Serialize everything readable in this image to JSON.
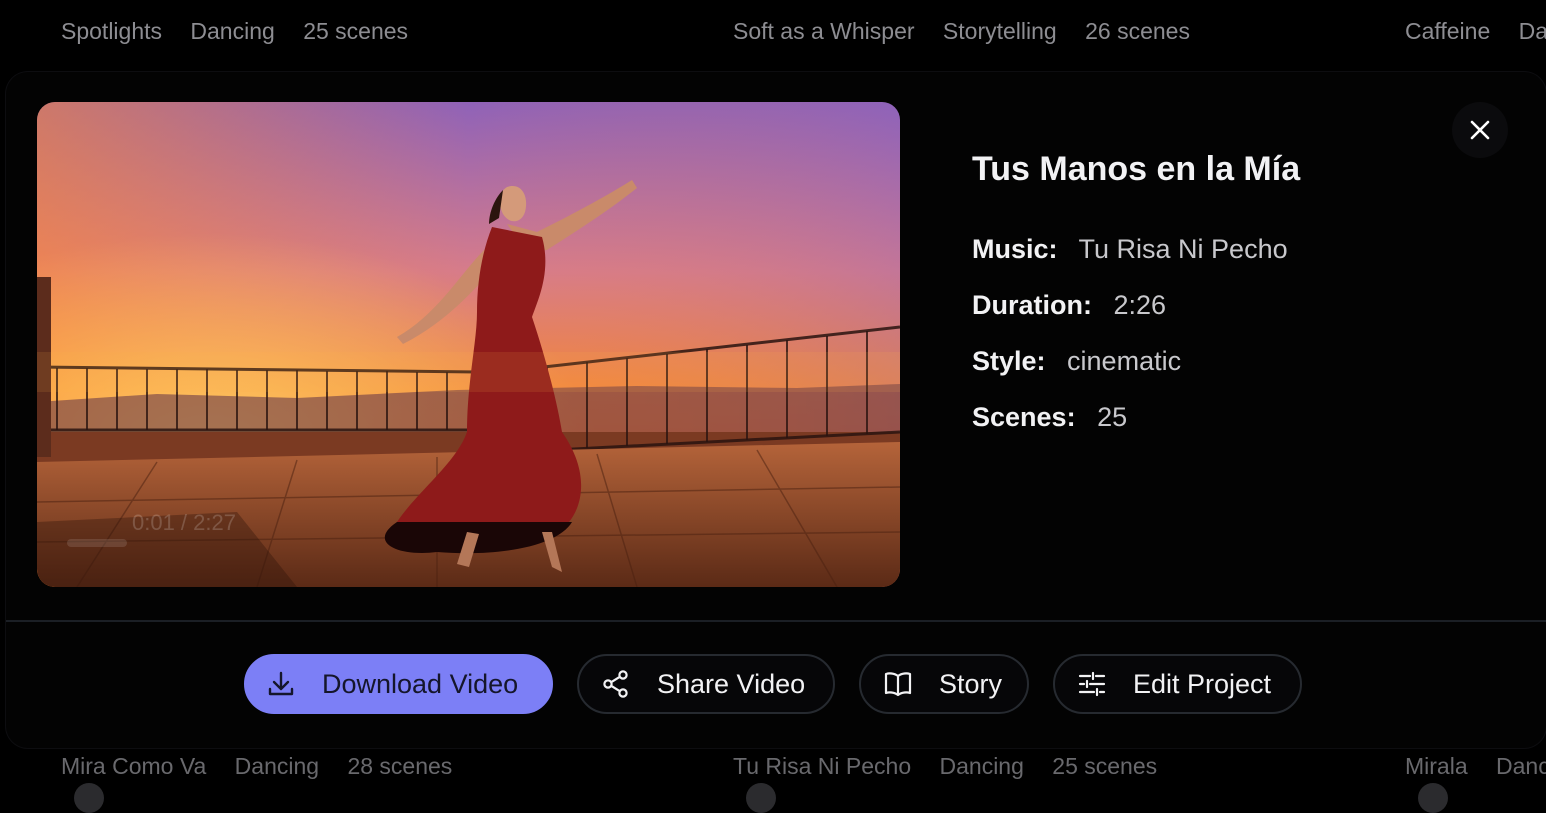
{
  "background_top": {
    "groups": [
      {
        "title": "Spotlights",
        "category": "Dancing",
        "scenes": "25 scenes"
      },
      {
        "title": "Soft as a Whisper",
        "category": "Storytelling",
        "scenes": "26 scenes"
      },
      {
        "title": "Caffeine",
        "category": "Da"
      }
    ]
  },
  "background_bottom": {
    "groups": [
      {
        "title": "Mira Como Va",
        "category": "Dancing",
        "scenes": "28 scenes"
      },
      {
        "title": "Tu Risa Ni Pecho",
        "category": "Dancing",
        "scenes": "25 scenes"
      },
      {
        "title": "Mirala",
        "category": "Danc"
      }
    ]
  },
  "modal": {
    "media": {
      "time": "0:01 / 2:27"
    },
    "title": "Tus Manos en la Mía",
    "details": [
      {
        "label": "Music:",
        "value": "Tu Risa Ni Pecho"
      },
      {
        "label": "Duration:",
        "value": "2:26"
      },
      {
        "label": "Style:",
        "value": "cinematic"
      },
      {
        "label": "Scenes:",
        "value": "25"
      }
    ],
    "actions": {
      "download": "Download Video",
      "share": "Share Video",
      "story": "Story",
      "edit": "Edit Project"
    },
    "icons": {
      "close": "close-icon",
      "download": "download-icon",
      "share": "share-icon",
      "story": "book-icon",
      "edit": "sliders-icon"
    },
    "colors": {
      "primary": "#7c7ff6",
      "background": "#030303",
      "button_border": "#262a30"
    }
  }
}
